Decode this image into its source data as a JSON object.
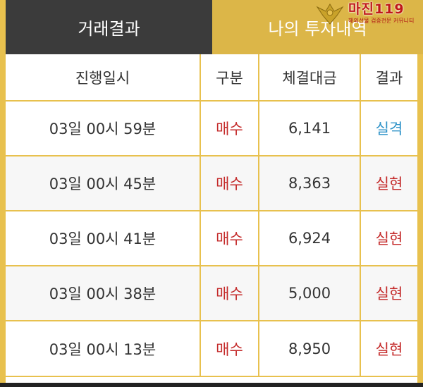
{
  "tabs": {
    "active_label": "거래결과",
    "inactive_label": "나의 투자내역"
  },
  "logo": {
    "title": "마진119",
    "subtitle": "해외선물 검증전문 커뮤니티"
  },
  "table": {
    "headers": [
      "진행일시",
      "구분",
      "체결대금",
      "결과"
    ],
    "rows": [
      {
        "datetime": "03일 00시 59분",
        "type": "매수",
        "amount": "6,141",
        "result": "실격"
      },
      {
        "datetime": "03일 00시 45분",
        "type": "매수",
        "amount": "8,363",
        "result": "실현"
      },
      {
        "datetime": "03일 00시 41분",
        "type": "매수",
        "amount": "6,924",
        "result": "실현"
      },
      {
        "datetime": "03일 00시 38분",
        "type": "매수",
        "amount": "5,000",
        "result": "실현"
      },
      {
        "datetime": "03일 00시 13분",
        "type": "매수",
        "amount": "8,950",
        "result": "실현"
      }
    ]
  },
  "colors": {
    "gold_border": "#e8c14e",
    "active_tab": "#3b3b3b",
    "buy_red": "#c42a2a",
    "fail_blue": "#2f93c8"
  }
}
